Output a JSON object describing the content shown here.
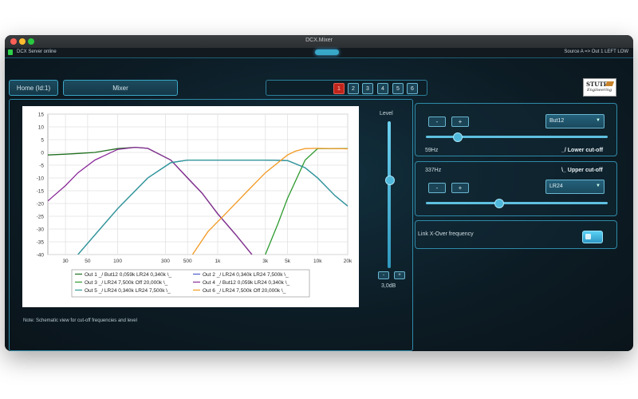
{
  "window": {
    "title": "DCX.Mixer"
  },
  "status": {
    "left": "DCX Server online",
    "right": "Source A => Out 1 LEFT LOW"
  },
  "nav": {
    "home_label": "Home (Id:1)",
    "mixer_label": "Mixer"
  },
  "outputs": {
    "buttons": [
      "1",
      "2",
      "3",
      "4",
      "5",
      "6"
    ],
    "selected": "1"
  },
  "logo": {
    "line1": "STUTE",
    "line2": "Engineering"
  },
  "level": {
    "label": "Level",
    "value": "3,0dB",
    "minus": "-",
    "plus": "+"
  },
  "lower": {
    "minus": "-",
    "plus": "+",
    "filter": "But12",
    "freq": "59Hz",
    "title": "_/ Lower cut-off"
  },
  "upper": {
    "minus": "-",
    "plus": "+",
    "filter": "LR24",
    "freq": "337Hz",
    "title": "\\_ Upper cut-off"
  },
  "link": {
    "label": "Link X-Over frequency",
    "enabled": true
  },
  "note": "Note: Schematic view for cut-off frequencies and level",
  "chart_data": {
    "type": "line",
    "x_scale": "log",
    "xlim": [
      20,
      20000
    ],
    "ylim": [
      -40,
      15
    ],
    "grid": true,
    "x_ticks": [
      30,
      50,
      100,
      300,
      500,
      1000,
      3000,
      5000,
      10000,
      20000
    ],
    "x_tick_labels": [
      "30",
      "50",
      "100",
      "300",
      "500",
      "1k",
      "3k",
      "5k",
      "10k",
      "20k"
    ],
    "y_ticks": [
      15,
      10,
      5,
      0,
      -5,
      -10,
      -15,
      -20,
      -25,
      -30,
      -35,
      -40
    ],
    "legend_position": "bottom",
    "series": [
      {
        "name": "Out 1 _/ But12 0,059k LR24 0,340k \\_",
        "color": "#1f6f1f",
        "x": [
          20,
          30,
          40,
          59,
          100,
          150,
          200,
          340,
          500,
          700,
          1000,
          1500,
          2200
        ],
        "y": [
          -1,
          -0.7,
          -0.4,
          0,
          1.5,
          2,
          1.6,
          -3,
          -10,
          -16,
          -24,
          -32,
          -40
        ]
      },
      {
        "name": "Out 2 _/ LR24 0,340k LR24 7,500k \\_",
        "color": "#4a5fc8",
        "x": [
          40,
          60,
          100,
          200,
          340,
          500,
          1000,
          3000,
          5000,
          7500,
          10000,
          15000,
          20000
        ],
        "y": [
          -40,
          -32,
          -22,
          -10,
          -4,
          -3,
          -3,
          -3,
          -3.2,
          -6,
          -10,
          -17,
          -21
        ]
      },
      {
        "name": "Out 3 _/ LR24 7,500k Off 20,000k \\_",
        "color": "#2e9a2e",
        "x": [
          3000,
          4000,
          5000,
          7500,
          10000,
          20000
        ],
        "y": [
          -40,
          -28,
          -18,
          -3,
          1.5,
          1.5
        ]
      },
      {
        "name": "Out 4 _/ But12 0,059k LR24 0,340k \\_",
        "color": "#8a2a9a",
        "x": [
          20,
          30,
          40,
          59,
          100,
          150,
          200,
          340,
          500,
          700,
          1000,
          1500,
          2200
        ],
        "y": [
          -19,
          -13,
          -8,
          -3,
          1.2,
          2,
          1.6,
          -3,
          -10,
          -16,
          -24,
          -32,
          -40
        ]
      },
      {
        "name": "Out 5 _/ LR24 0,340k LR24 7,500k \\_",
        "color": "#2f9a96",
        "x": [
          40,
          60,
          100,
          200,
          340,
          500,
          1000,
          3000,
          5000,
          7500,
          10000,
          15000,
          20000
        ],
        "y": [
          -40,
          -32,
          -22,
          -10,
          -4,
          -3,
          -3,
          -3,
          -3.2,
          -6,
          -10,
          -17,
          -21
        ]
      },
      {
        "name": "Out 6 _/ LR24 7,500k Off 20,000k \\_",
        "color": "#f39a24",
        "x": [
          560,
          800,
          1200,
          2000,
          3000,
          5000,
          6000,
          7500,
          10000,
          20000
        ],
        "y": [
          -40,
          -31,
          -24,
          -15,
          -8,
          -1,
          0.5,
          1.5,
          1.6,
          1.4
        ]
      }
    ]
  }
}
